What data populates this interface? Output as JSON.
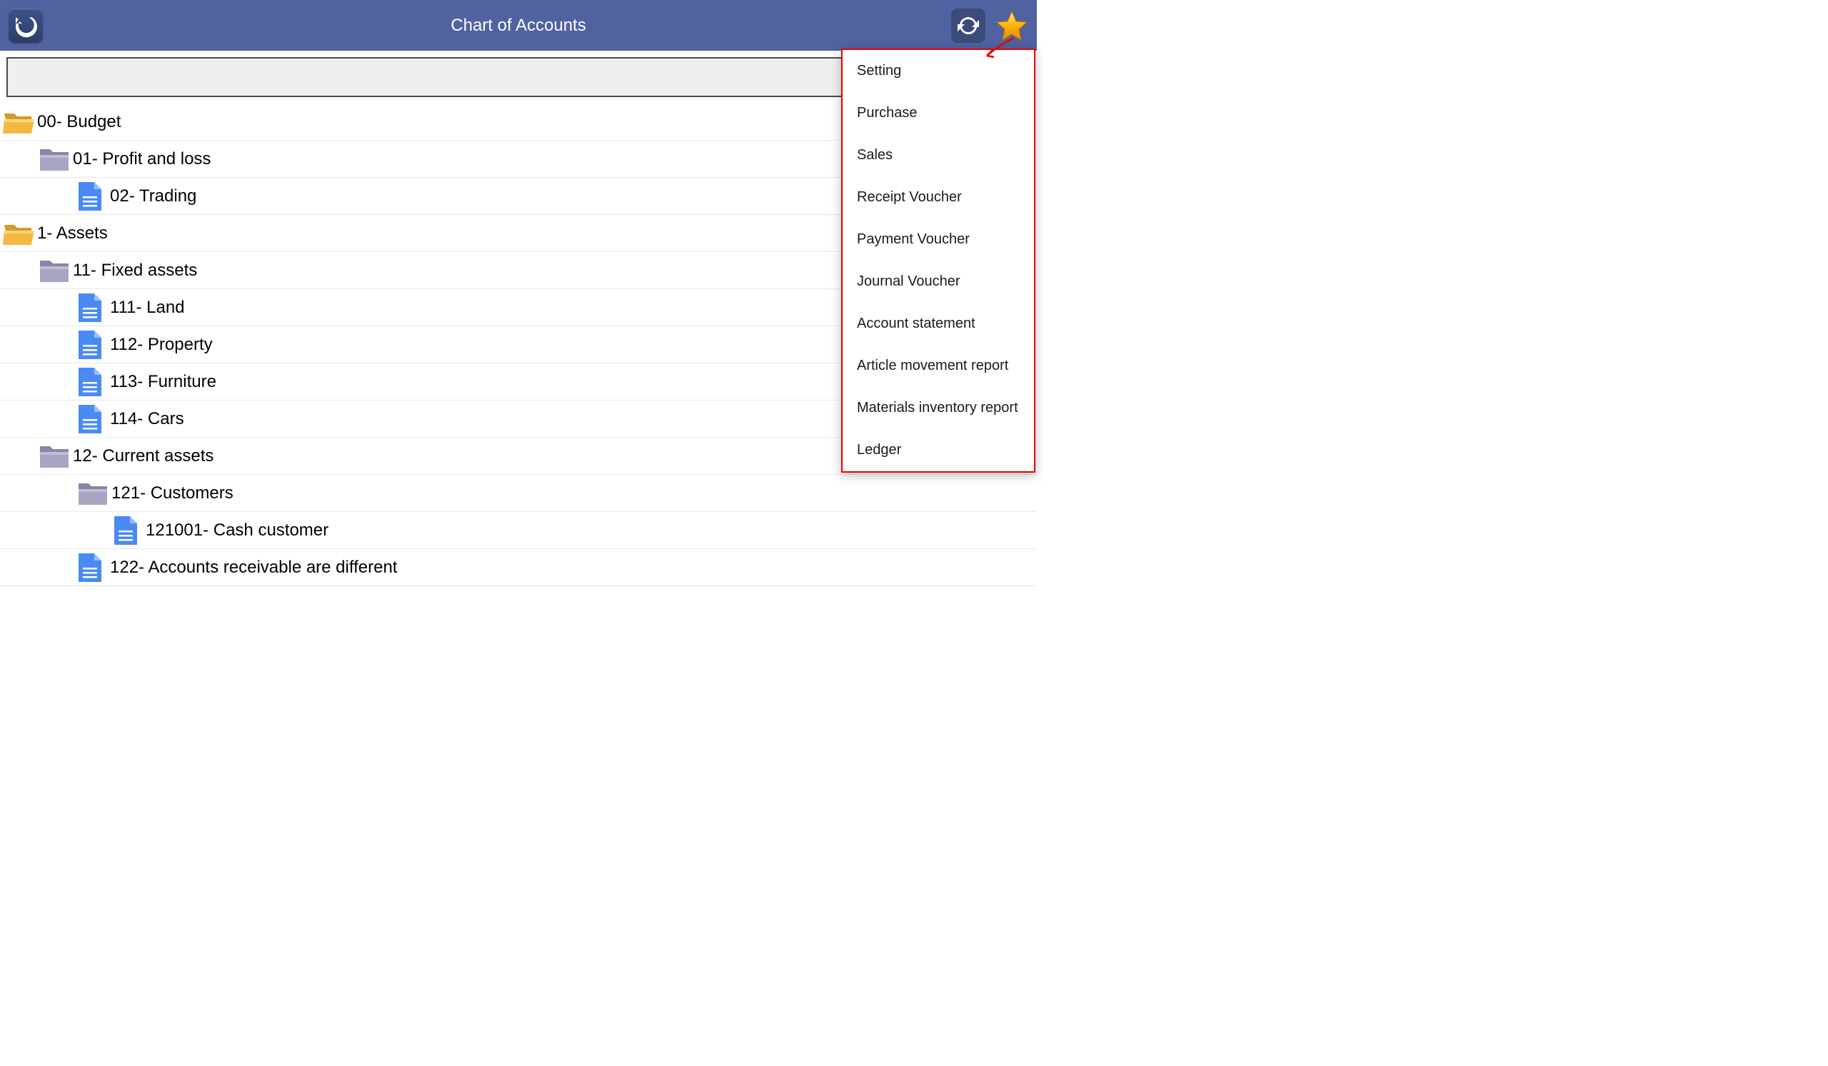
{
  "header": {
    "title": "Chart of Accounts"
  },
  "search": {
    "value": "",
    "placeholder": ""
  },
  "tree": {
    "items": [
      {
        "label": "00- Budget",
        "type": "folder-yellow",
        "indent": 0
      },
      {
        "label": "01- Profit and loss",
        "type": "folder-purple",
        "indent": 1
      },
      {
        "label": "02- Trading",
        "type": "doc",
        "indent": 2
      },
      {
        "label": "1- Assets",
        "type": "folder-yellow",
        "indent": 0
      },
      {
        "label": "11- Fixed assets",
        "type": "folder-purple",
        "indent": 1
      },
      {
        "label": "111- Land",
        "type": "doc",
        "indent": 2
      },
      {
        "label": "112- Property",
        "type": "doc",
        "indent": 2
      },
      {
        "label": "113- Furniture",
        "type": "doc",
        "indent": 2
      },
      {
        "label": "114- Cars",
        "type": "doc",
        "indent": 2
      },
      {
        "label": "12- Current assets",
        "type": "folder-purple",
        "indent": 1
      },
      {
        "label": "121- Customers",
        "type": "folder-purple",
        "indent": 2
      },
      {
        "label": "121001- Cash customer",
        "type": "doc",
        "indent": 3
      },
      {
        "label": "122- Accounts receivable are different",
        "type": "doc",
        "indent": 2
      }
    ]
  },
  "menu": {
    "items": [
      {
        "label": "Setting"
      },
      {
        "label": "Purchase"
      },
      {
        "label": "Sales"
      },
      {
        "label": "Receipt Voucher"
      },
      {
        "label": "Payment Voucher"
      },
      {
        "label": "Journal Voucher"
      },
      {
        "label": "Account statement"
      },
      {
        "label": "Article movement report"
      },
      {
        "label": "Materials inventory report"
      },
      {
        "label": "Ledger"
      }
    ]
  }
}
